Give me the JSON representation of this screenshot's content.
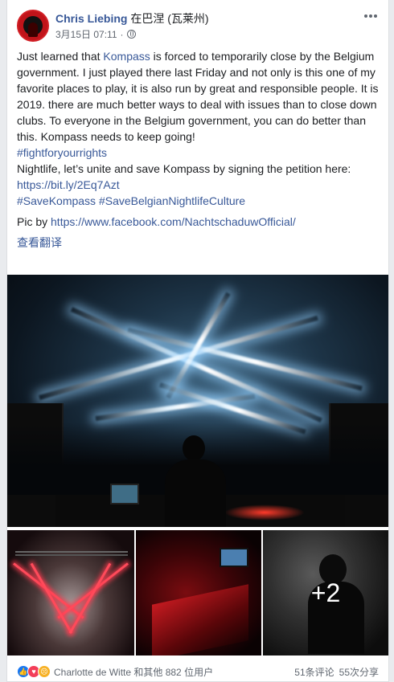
{
  "post": {
    "author": "Chris Liebing",
    "location": "在巴涅 (瓦莱州)",
    "timestamp": "3月15日 07:11",
    "separator": "·",
    "privacy_icon": "globe-icon",
    "more_icon": "more-options-icon"
  },
  "text": {
    "p1_pre": "Just learned that ",
    "p1_link": "Kompass",
    "p1_post": " is forced to temporarily close by the Belgium government. I just played there last Friday and not only is this one of my favorite places to play, it is also run by great and responsible people. It is 2019. there are much better ways to deal with issues than to close down clubs. To everyone in the Belgium government, you can do better than this. Kompass needs to keep going!",
    "hashtag1": "#fightforyourrights",
    "p2": "Nightlife, let’s unite and save Kompass by signing the petition here:",
    "petition_link": "https://bit.ly/2Eq7Azt",
    "hashtags2a": "#SaveKompass",
    "hashtags2b": "#SaveBelgianNightlifeCulture",
    "pic_by": "Pic by ",
    "pic_link": "https://www.facebook.com/NachtschaduwOfficial/",
    "translate": "查看翻译"
  },
  "photos": {
    "more_count": "+2"
  },
  "footer": {
    "reactions": [
      "like",
      "love",
      "sad"
    ],
    "reaction_text": "Charlotte de Witte 和其他 882 位用户",
    "comments": "51条评论",
    "shares": "55次分享"
  }
}
